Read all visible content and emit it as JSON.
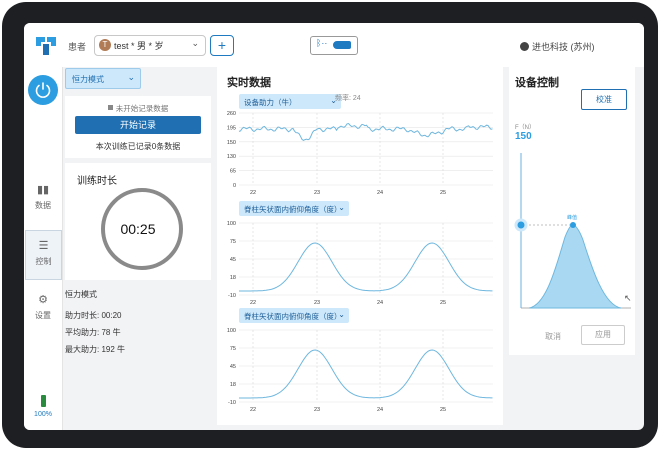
{
  "header": {
    "patient_label": "患者",
    "patient_avatar": "T",
    "patient_value": "test * 男 * 岁",
    "add_symbol": "+",
    "bluetooth_icon": "bluetooth-icon",
    "company": "进也科技 (苏州)"
  },
  "nav": {
    "items": [
      {
        "label": "数据",
        "icon": "bar-chart-icon"
      },
      {
        "label": "控制",
        "icon": "sliders-icon",
        "active": true
      },
      {
        "label": "设置",
        "icon": "gear-icon"
      }
    ],
    "battery": "100%"
  },
  "left_panel": {
    "mode": "恒力模式",
    "record_status": "未开始记录数据",
    "record_button": "开始记录",
    "record_count": "本次训练已记录0条数据",
    "time_title": "训练时长",
    "time_value": "00:25",
    "stats_title": "恒力模式",
    "stat_duration": "助力时长:  00:20",
    "stat_avg": "平均助力:   78 牛",
    "stat_max": "最大助力:   192 牛"
  },
  "realtime": {
    "title": "实时数据",
    "frequency": "频率: 24",
    "x_ticks": [
      "22",
      "23",
      "24",
      "25"
    ],
    "chart1": {
      "selector": "设备助力（牛）",
      "y_ticks": [
        "260",
        "195",
        "150",
        "130",
        "65",
        "0"
      ]
    },
    "chart2": {
      "selector": "脊柱矢状面内俯仰角度（度）",
      "y_ticks": [
        "100",
        "75",
        "45",
        "18",
        "-10"
      ]
    },
    "chart3": {
      "selector": "脊柱矢状面内俯仰角度（度）",
      "y_ticks": [
        "100",
        "75",
        "45",
        "18",
        "-10"
      ]
    }
  },
  "device_control": {
    "title": "设备控制",
    "calibrate_button": "校准",
    "f_label": "F（N）",
    "f_value": "150",
    "peak_label": "峰值",
    "cancel": "取消",
    "apply": "应用"
  },
  "colors": {
    "accent": "#1f6fb2",
    "line": "#6fb7de",
    "fill": "#a9d9f2",
    "light": "#cde8fa"
  }
}
